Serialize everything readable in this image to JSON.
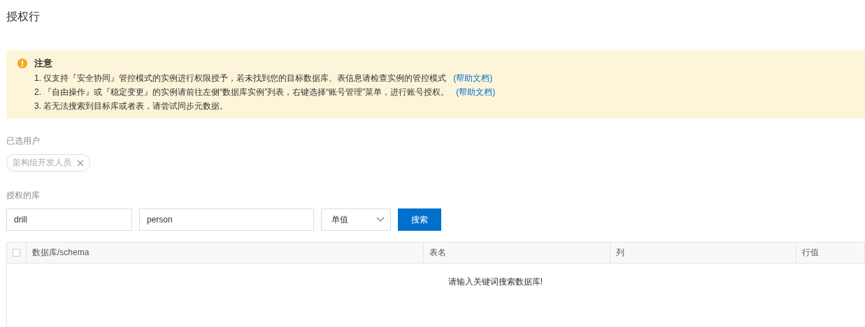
{
  "page": {
    "title": "授权行"
  },
  "notice": {
    "title": "注意",
    "items": [
      {
        "text": "1. 仅支持『安全协同』管控模式的实例进行权限授予，若未找到您的目标数据库、表信息请检查实例的管控模式",
        "link": "(帮助文档)"
      },
      {
        "text": "2. 『自由操作』或『稳定变更』的实例请前往左侧“数据库实例”列表，右键选择“账号管理”菜单，进行账号授权。",
        "link": "(帮助文档)"
      },
      {
        "text": "3. 若无法搜索到目标库或者表，请尝试同步元数据。"
      }
    ]
  },
  "selected_users": {
    "label": "已选用户",
    "tags": [
      {
        "label": "架构组开发人员"
      }
    ]
  },
  "database": {
    "label": "授权的库",
    "db_value": "drill",
    "table_value": "person",
    "mode": "单值",
    "search_button": "搜索"
  },
  "table": {
    "select_all": {
      "checked": false
    },
    "columns": [
      "数据库/schema",
      "表名",
      "列",
      "行值"
    ],
    "empty_message": "请输入关键词搜索数据库!"
  }
}
